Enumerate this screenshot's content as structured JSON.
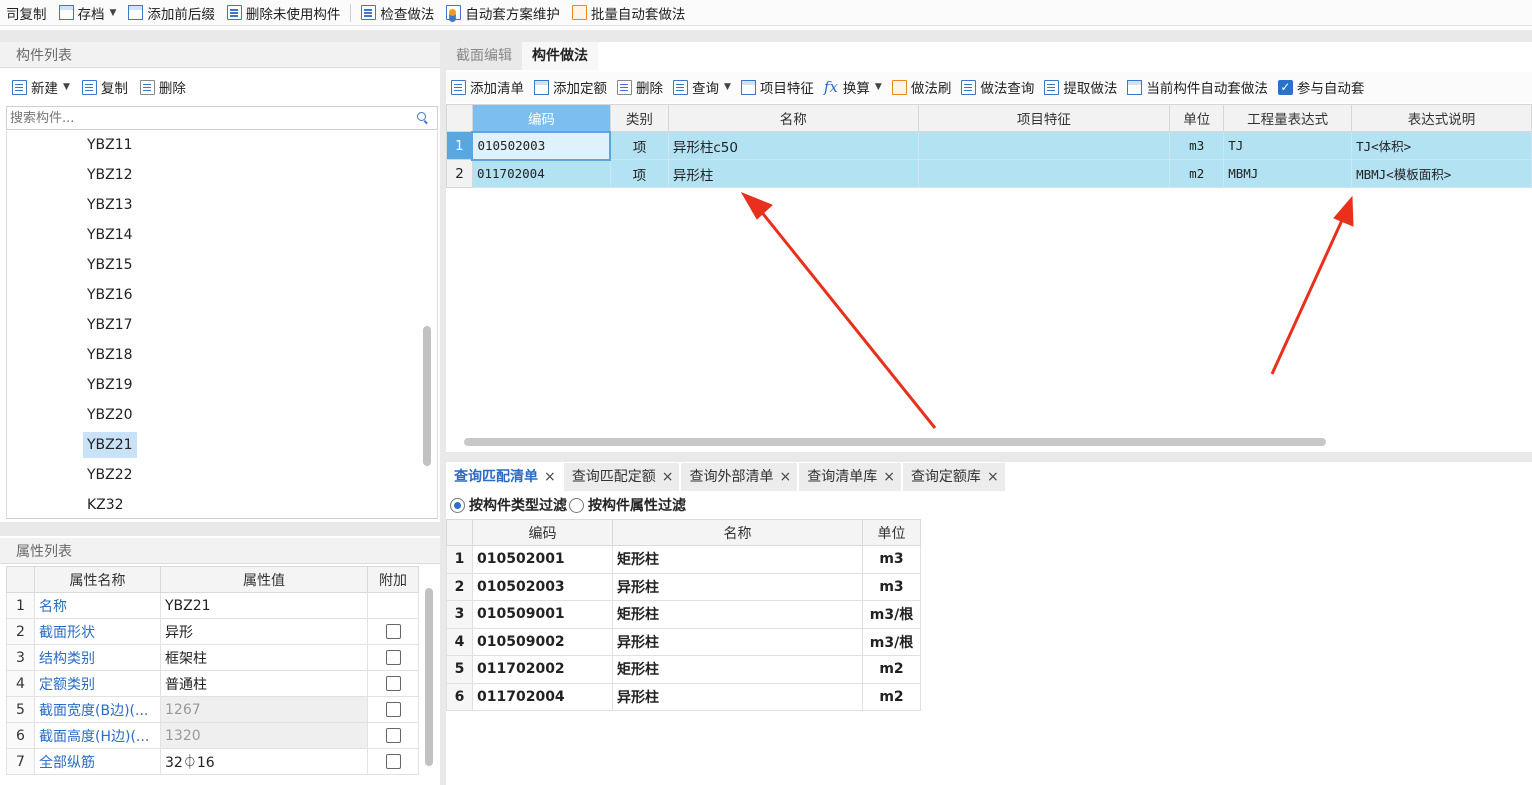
{
  "toolbar": {
    "items": [
      {
        "label": "司复制",
        "icon": "copy-icon"
      },
      {
        "label": "存档",
        "icon": "archive-icon",
        "dropdown": true
      },
      {
        "label": "添加前后缀",
        "icon": "prefix-icon"
      },
      {
        "label": "删除未使用构件",
        "icon": "delete-unused-icon"
      },
      {
        "label": "检查做法",
        "icon": "check-icon"
      },
      {
        "label": "自动套方案维护",
        "icon": "auto-scheme-icon"
      },
      {
        "label": "批量自动套做法",
        "icon": "batch-auto-icon"
      }
    ]
  },
  "component_panel": {
    "title": "构件列表",
    "new_label": "新建",
    "copy_label": "复制",
    "delete_label": "删除",
    "search_placeholder": "搜索构件...",
    "items": [
      "YBZ11",
      "YBZ12",
      "YBZ13",
      "YBZ14",
      "YBZ15",
      "YBZ16",
      "YBZ17",
      "YBZ18",
      "YBZ19",
      "YBZ20",
      "YBZ21",
      "YBZ22",
      "KZ32"
    ],
    "selected": "YBZ21"
  },
  "property_panel": {
    "title": "属性列表",
    "headers": [
      "属性名称",
      "属性值",
      "附加"
    ],
    "rows": [
      {
        "idx": "1",
        "name": "名称",
        "value": "YBZ21",
        "has_check": false,
        "grayed": false
      },
      {
        "idx": "2",
        "name": "截面形状",
        "value": "异形",
        "has_check": true,
        "grayed": false
      },
      {
        "idx": "3",
        "name": "结构类别",
        "value": "框架柱",
        "has_check": true,
        "grayed": false
      },
      {
        "idx": "4",
        "name": "定额类别",
        "value": "普通柱",
        "has_check": true,
        "grayed": false
      },
      {
        "idx": "5",
        "name": "截面宽度(B边)(...",
        "value": "1267",
        "has_check": true,
        "grayed": true
      },
      {
        "idx": "6",
        "name": "截面高度(H边)(...",
        "value": "1320",
        "has_check": true,
        "grayed": true
      },
      {
        "idx": "7",
        "name": "全部纵筋",
        "value": "32⏀16",
        "has_check": true,
        "grayed": false
      }
    ]
  },
  "method_panel": {
    "tabs": [
      "截面编辑",
      "构件做法"
    ],
    "active_tab": "构件做法",
    "toolbar": [
      {
        "label": "添加清单",
        "icon": "add-list-icon"
      },
      {
        "label": "添加定额",
        "icon": "add-quota-icon"
      },
      {
        "label": "删除",
        "icon": "delete-icon"
      },
      {
        "label": "查询",
        "icon": "query-icon",
        "dropdown": true
      },
      {
        "label": "项目特征",
        "icon": "feature-icon"
      },
      {
        "label": "换算",
        "icon": "fx-icon",
        "dropdown": true
      },
      {
        "label": "做法刷",
        "icon": "brush-icon"
      },
      {
        "label": "做法查询",
        "icon": "method-query-icon"
      },
      {
        "label": "提取做法",
        "icon": "extract-icon"
      },
      {
        "label": "当前构件自动套做法",
        "icon": "auto-apply-icon"
      },
      {
        "label": "参与自动套",
        "icon": "checkbox-icon",
        "checked": true
      }
    ],
    "headers": [
      "编码",
      "类别",
      "名称",
      "项目特征",
      "单位",
      "工程量表达式",
      "表达式说明"
    ],
    "rows": [
      {
        "idx": "1",
        "code": "010502003",
        "type": "项",
        "name": "异形柱c50",
        "feature": "",
        "unit": "m3",
        "expr": "TJ",
        "desc": "TJ<体积>"
      },
      {
        "idx": "2",
        "code": "011702004",
        "type": "项",
        "name": "异形柱",
        "feature": "",
        "unit": "m2",
        "expr": "MBMJ",
        "desc": "MBMJ<模板面积>"
      }
    ]
  },
  "query_panel": {
    "tabs": [
      "查询匹配清单",
      "查询匹配定额",
      "查询外部清单",
      "查询清单库",
      "查询定额库"
    ],
    "active_tab": "查询匹配清单",
    "filter_type": "按构件类型过滤",
    "filter_attr": "按构件属性过滤",
    "headers": [
      "编码",
      "名称",
      "单位"
    ],
    "rows": [
      {
        "idx": "1",
        "code": "010502001",
        "name": "矩形柱",
        "unit": "m3"
      },
      {
        "idx": "2",
        "code": "010502003",
        "name": "异形柱",
        "unit": "m3"
      },
      {
        "idx": "3",
        "code": "010509001",
        "name": "矩形柱",
        "unit": "m3/根"
      },
      {
        "idx": "4",
        "code": "010509002",
        "name": "异形柱",
        "unit": "m3/根"
      },
      {
        "idx": "5",
        "code": "011702002",
        "name": "矩形柱",
        "unit": "m2"
      },
      {
        "idx": "6",
        "code": "011702004",
        "name": "异形柱",
        "unit": "m2"
      }
    ]
  },
  "colors": {
    "accent": "#2b6cc4",
    "row_highlight": "#b3e2f3",
    "header_highlight": "#7cbef0",
    "arrow": "#e8301c"
  }
}
